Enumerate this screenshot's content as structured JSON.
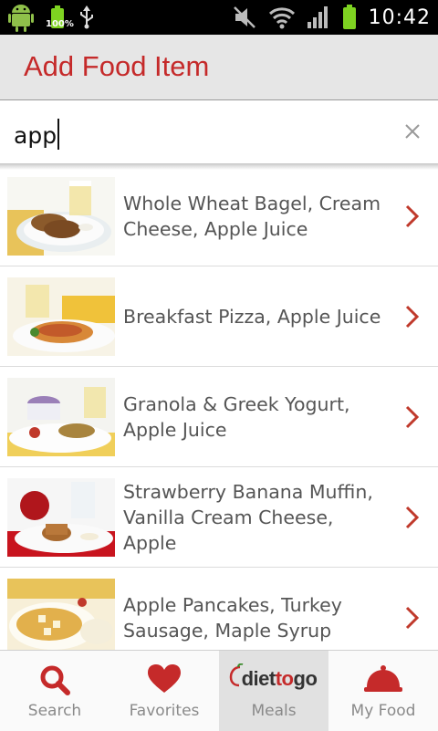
{
  "status_bar": {
    "battery_percent": "100%",
    "time": "10:42"
  },
  "header": {
    "title": "Add Food Item"
  },
  "search": {
    "value": "app"
  },
  "results": [
    {
      "label": "Whole Wheat Bagel, Cream Cheese, Apple Juice"
    },
    {
      "label": "Breakfast Pizza, Apple Juice"
    },
    {
      "label": "Granola & Greek Yogurt, Apple Juice"
    },
    {
      "label": "Strawberry Banana Muffin, Vanilla Cream Cheese, Apple"
    },
    {
      "label": "Apple Pancakes, Turkey Sausage, Maple Syrup"
    }
  ],
  "bottom_nav": {
    "items": [
      {
        "label": "Search"
      },
      {
        "label": "Favorites"
      },
      {
        "label": "Meals"
      },
      {
        "label": "My Food"
      }
    ],
    "logo": {
      "part1": "diet",
      "part2": "to",
      "part3": "go"
    }
  },
  "colors": {
    "accent": "#c52a2a",
    "status_green": "#7ed321"
  }
}
